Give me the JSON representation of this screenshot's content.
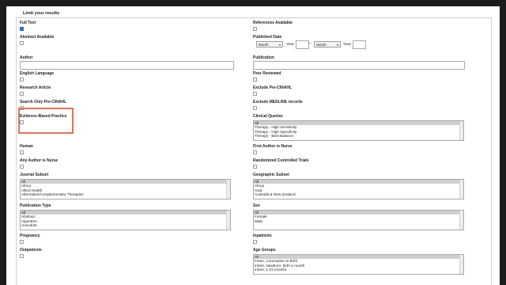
{
  "form": {
    "legend": "Limit your results",
    "full_text": {
      "label": "Full Text",
      "checked": true
    },
    "abstract_available": {
      "label": "Abstract Available",
      "checked": false
    },
    "author": {
      "label": "Author",
      "value": ""
    },
    "english_language": {
      "label": "English Language",
      "checked": false
    },
    "research_article": {
      "label": "Research Article",
      "checked": false
    },
    "search_only_pre_cinahl": {
      "label": "Search Only Pre-CINAHL",
      "checked": false
    },
    "evidence_based_practice": {
      "label": "Evidence-Based Practice",
      "checked": false
    },
    "human": {
      "label": "Human",
      "checked": false
    },
    "any_author_is_nurse": {
      "label": "Any Author is Nurse",
      "checked": false
    },
    "journal_subset": {
      "label": "Journal Subset",
      "options": [
        "All",
        "Africa",
        "Allied Health",
        "Alternative/Complementary Therapies"
      ]
    },
    "publication_type": {
      "label": "Publication Type",
      "options": [
        "All",
        "Abstract",
        "Algorithm",
        "Anecdote"
      ]
    },
    "pregnancy": {
      "label": "Pregnancy",
      "checked": false
    },
    "outpatients": {
      "label": "Outpatients",
      "checked": false
    },
    "references_available": {
      "label": "References Available",
      "checked": false
    },
    "published_date": {
      "label": "Published Date",
      "month_label": "Month",
      "year_label": "Year:",
      "separator": "—",
      "from_year": "",
      "to_year": ""
    },
    "publication": {
      "label": "Publication",
      "value": ""
    },
    "peer_reviewed": {
      "label": "Peer Reviewed",
      "checked": false
    },
    "exclude_pre_cinahl": {
      "label": "Exclude Pre-CINAHL",
      "checked": false
    },
    "exclude_medline": {
      "label": "Exclude MEDLINE records",
      "checked": false
    },
    "clinical_queries": {
      "label": "Clinical Queries",
      "options": [
        "All",
        "Therapy - High Sensitivity",
        "Therapy - High Specificity",
        "Therapy - Best Balance"
      ]
    },
    "first_author_is_nurse": {
      "label": "First Author is Nurse",
      "checked": false
    },
    "randomized_controlled_trials": {
      "label": "Randomized Controlled Trials",
      "checked": false
    },
    "geographic_subset": {
      "label": "Geographic Subset",
      "options": [
        "All",
        "Africa",
        "Asia",
        "Australia & New Zealand"
      ]
    },
    "sex": {
      "label": "Sex",
      "options": [
        "All",
        "Female",
        "Male"
      ]
    },
    "inpatients": {
      "label": "Inpatients",
      "checked": false
    },
    "age_groups": {
      "label": "Age Groups",
      "options": [
        "All",
        "Fetus, Conception to Birth",
        "Infant, Newborn: birth-1 month",
        "Infant: 1-23 months"
      ]
    }
  },
  "colors": {
    "highlight": "#d8775e",
    "checked": "#3b78d8",
    "background": "#1c1c1c"
  }
}
